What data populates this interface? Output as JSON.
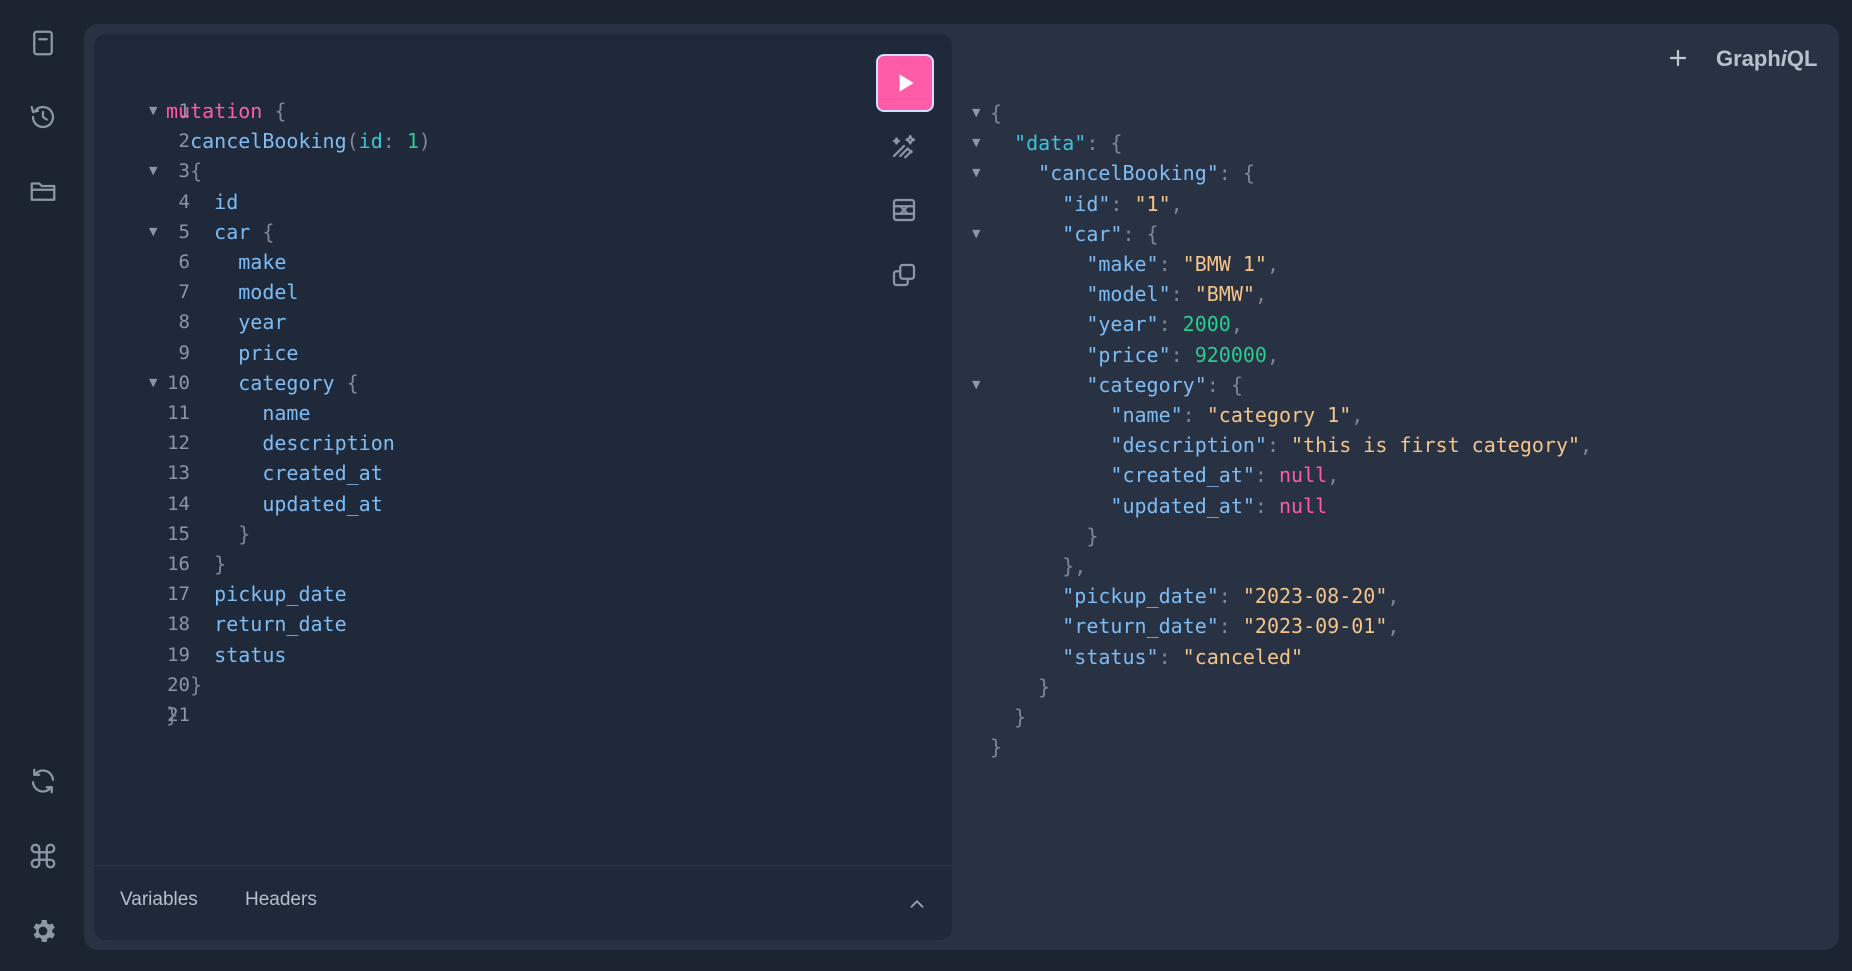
{
  "app": {
    "brand_prefix": "Graph",
    "brand_italic": "i",
    "brand_suffix": "QL",
    "add_tab_icon": "plus-icon"
  },
  "sidebar": {
    "items": [
      {
        "name": "docs",
        "icon": "docs-icon"
      },
      {
        "name": "history",
        "icon": "history-icon"
      },
      {
        "name": "explorer",
        "icon": "folder-icon"
      },
      {
        "name": "refetch-schema",
        "icon": "refresh-icon"
      },
      {
        "name": "shortcuts",
        "icon": "command-icon"
      },
      {
        "name": "settings",
        "icon": "gear-icon"
      }
    ]
  },
  "editor": {
    "lines": [
      {
        "n": "1",
        "fold": true,
        "tokens": [
          {
            "c": "kw",
            "t": "mutation"
          },
          {
            "c": "punct",
            "t": " {"
          }
        ]
      },
      {
        "n": "2",
        "fold": false,
        "tokens": [
          {
            "c": "fn",
            "t": "  cancelBooking"
          },
          {
            "c": "punct",
            "t": "("
          },
          {
            "c": "arg",
            "t": "id"
          },
          {
            "c": "punct",
            "t": ": "
          },
          {
            "c": "num",
            "t": "1"
          },
          {
            "c": "punct",
            "t": ")"
          }
        ]
      },
      {
        "n": "3",
        "fold": true,
        "tokens": [
          {
            "c": "punct",
            "t": "  {"
          }
        ]
      },
      {
        "n": "4",
        "fold": false,
        "tokens": [
          {
            "c": "fn",
            "t": "    id"
          }
        ]
      },
      {
        "n": "5",
        "fold": true,
        "tokens": [
          {
            "c": "fn",
            "t": "    car"
          },
          {
            "c": "punct",
            "t": " {"
          }
        ]
      },
      {
        "n": "6",
        "fold": false,
        "tokens": [
          {
            "c": "fn",
            "t": "      make"
          }
        ]
      },
      {
        "n": "7",
        "fold": false,
        "tokens": [
          {
            "c": "fn",
            "t": "      model"
          }
        ]
      },
      {
        "n": "8",
        "fold": false,
        "tokens": [
          {
            "c": "fn",
            "t": "      year"
          }
        ]
      },
      {
        "n": "9",
        "fold": false,
        "tokens": [
          {
            "c": "fn",
            "t": "      price"
          }
        ]
      },
      {
        "n": "10",
        "fold": true,
        "tokens": [
          {
            "c": "fn",
            "t": "      category"
          },
          {
            "c": "punct",
            "t": " {"
          }
        ]
      },
      {
        "n": "11",
        "fold": false,
        "tokens": [
          {
            "c": "fn",
            "t": "        name"
          }
        ]
      },
      {
        "n": "12",
        "fold": false,
        "tokens": [
          {
            "c": "fn",
            "t": "        description"
          }
        ]
      },
      {
        "n": "13",
        "fold": false,
        "tokens": [
          {
            "c": "fn",
            "t": "        created_at"
          }
        ]
      },
      {
        "n": "14",
        "fold": false,
        "tokens": [
          {
            "c": "fn",
            "t": "        updated_at"
          }
        ]
      },
      {
        "n": "15",
        "fold": false,
        "tokens": [
          {
            "c": "punct",
            "t": "      }"
          }
        ]
      },
      {
        "n": "16",
        "fold": false,
        "tokens": [
          {
            "c": "punct",
            "t": "    }"
          }
        ]
      },
      {
        "n": "17",
        "fold": false,
        "tokens": [
          {
            "c": "fn",
            "t": "    pickup_date"
          }
        ]
      },
      {
        "n": "18",
        "fold": false,
        "tokens": [
          {
            "c": "fn",
            "t": "    return_date"
          }
        ]
      },
      {
        "n": "19",
        "fold": false,
        "tokens": [
          {
            "c": "fn",
            "t": "    status"
          }
        ]
      },
      {
        "n": "20",
        "fold": false,
        "tokens": [
          {
            "c": "punct",
            "t": "  }"
          }
        ]
      },
      {
        "n": "21",
        "fold": false,
        "tokens": [
          {
            "c": "punct",
            "t": "}"
          }
        ]
      }
    ],
    "toolbar": {
      "run_icon": "play-icon",
      "prettify_icon": "prettify-icon",
      "merge_icon": "merge-fragments-icon",
      "copy_icon": "copy-icon"
    },
    "bottom_tabs": {
      "variables": "Variables",
      "headers": "Headers",
      "toggle_icon": "chevron-up-icon"
    }
  },
  "response": {
    "lines": [
      {
        "fold": true,
        "tokens": [
          {
            "c": "punct",
            "t": "{"
          }
        ]
      },
      {
        "fold": true,
        "tokens": [
          {
            "c": "keyd",
            "t": "  \"data\""
          },
          {
            "c": "punct",
            "t": ": {"
          }
        ]
      },
      {
        "fold": true,
        "tokens": [
          {
            "c": "key",
            "t": "    \"cancelBooking\""
          },
          {
            "c": "punct",
            "t": ": {"
          }
        ]
      },
      {
        "fold": false,
        "tokens": [
          {
            "c": "key",
            "t": "      \"id\""
          },
          {
            "c": "punct",
            "t": ": "
          },
          {
            "c": "str",
            "t": "\"1\""
          },
          {
            "c": "punct",
            "t": ","
          }
        ]
      },
      {
        "fold": true,
        "tokens": [
          {
            "c": "key",
            "t": "      \"car\""
          },
          {
            "c": "punct",
            "t": ": {"
          }
        ]
      },
      {
        "fold": false,
        "tokens": [
          {
            "c": "key",
            "t": "        \"make\""
          },
          {
            "c": "punct",
            "t": ": "
          },
          {
            "c": "str",
            "t": "\"BMW 1\""
          },
          {
            "c": "punct",
            "t": ","
          }
        ]
      },
      {
        "fold": false,
        "tokens": [
          {
            "c": "key",
            "t": "        \"model\""
          },
          {
            "c": "punct",
            "t": ": "
          },
          {
            "c": "str",
            "t": "\"BMW\""
          },
          {
            "c": "punct",
            "t": ","
          }
        ]
      },
      {
        "fold": false,
        "tokens": [
          {
            "c": "key",
            "t": "        \"year\""
          },
          {
            "c": "punct",
            "t": ": "
          },
          {
            "c": "num",
            "t": "2000"
          },
          {
            "c": "punct",
            "t": ","
          }
        ]
      },
      {
        "fold": false,
        "tokens": [
          {
            "c": "key",
            "t": "        \"price\""
          },
          {
            "c": "punct",
            "t": ": "
          },
          {
            "c": "num",
            "t": "920000"
          },
          {
            "c": "punct",
            "t": ","
          }
        ]
      },
      {
        "fold": true,
        "tokens": [
          {
            "c": "key",
            "t": "        \"category\""
          },
          {
            "c": "punct",
            "t": ": {"
          }
        ]
      },
      {
        "fold": false,
        "tokens": [
          {
            "c": "key",
            "t": "          \"name\""
          },
          {
            "c": "punct",
            "t": ": "
          },
          {
            "c": "str",
            "t": "\"category 1\""
          },
          {
            "c": "punct",
            "t": ","
          }
        ]
      },
      {
        "fold": false,
        "tokens": [
          {
            "c": "key",
            "t": "          \"description\""
          },
          {
            "c": "punct",
            "t": ": "
          },
          {
            "c": "str",
            "t": "\"this is first category\""
          },
          {
            "c": "punct",
            "t": ","
          }
        ]
      },
      {
        "fold": false,
        "tokens": [
          {
            "c": "key",
            "t": "          \"created_at\""
          },
          {
            "c": "punct",
            "t": ": "
          },
          {
            "c": "nul",
            "t": "null"
          },
          {
            "c": "punct",
            "t": ","
          }
        ]
      },
      {
        "fold": false,
        "tokens": [
          {
            "c": "key",
            "t": "          \"updated_at\""
          },
          {
            "c": "punct",
            "t": ": "
          },
          {
            "c": "nul",
            "t": "null"
          }
        ]
      },
      {
        "fold": false,
        "tokens": [
          {
            "c": "punct",
            "t": "        }"
          }
        ]
      },
      {
        "fold": false,
        "tokens": [
          {
            "c": "punct",
            "t": "      },"
          }
        ]
      },
      {
        "fold": false,
        "tokens": [
          {
            "c": "key",
            "t": "      \"pickup_date\""
          },
          {
            "c": "punct",
            "t": ": "
          },
          {
            "c": "str",
            "t": "\"2023-08-20\""
          },
          {
            "c": "punct",
            "t": ","
          }
        ]
      },
      {
        "fold": false,
        "tokens": [
          {
            "c": "key",
            "t": "      \"return_date\""
          },
          {
            "c": "punct",
            "t": ": "
          },
          {
            "c": "str",
            "t": "\"2023-09-01\""
          },
          {
            "c": "punct",
            "t": ","
          }
        ]
      },
      {
        "fold": false,
        "tokens": [
          {
            "c": "key",
            "t": "      \"status\""
          },
          {
            "c": "punct",
            "t": ": "
          },
          {
            "c": "str",
            "t": "\"canceled\""
          }
        ]
      },
      {
        "fold": false,
        "tokens": [
          {
            "c": "punct",
            "t": "    }"
          }
        ]
      },
      {
        "fold": false,
        "tokens": [
          {
            "c": "punct",
            "t": "  }"
          }
        ]
      },
      {
        "fold": false,
        "tokens": [
          {
            "c": "punct",
            "t": "}"
          }
        ]
      }
    ]
  },
  "colors": {
    "background": "#1c2431",
    "panel": "#283243",
    "editor": "#1f293a",
    "accent": "#ff5ca8"
  }
}
